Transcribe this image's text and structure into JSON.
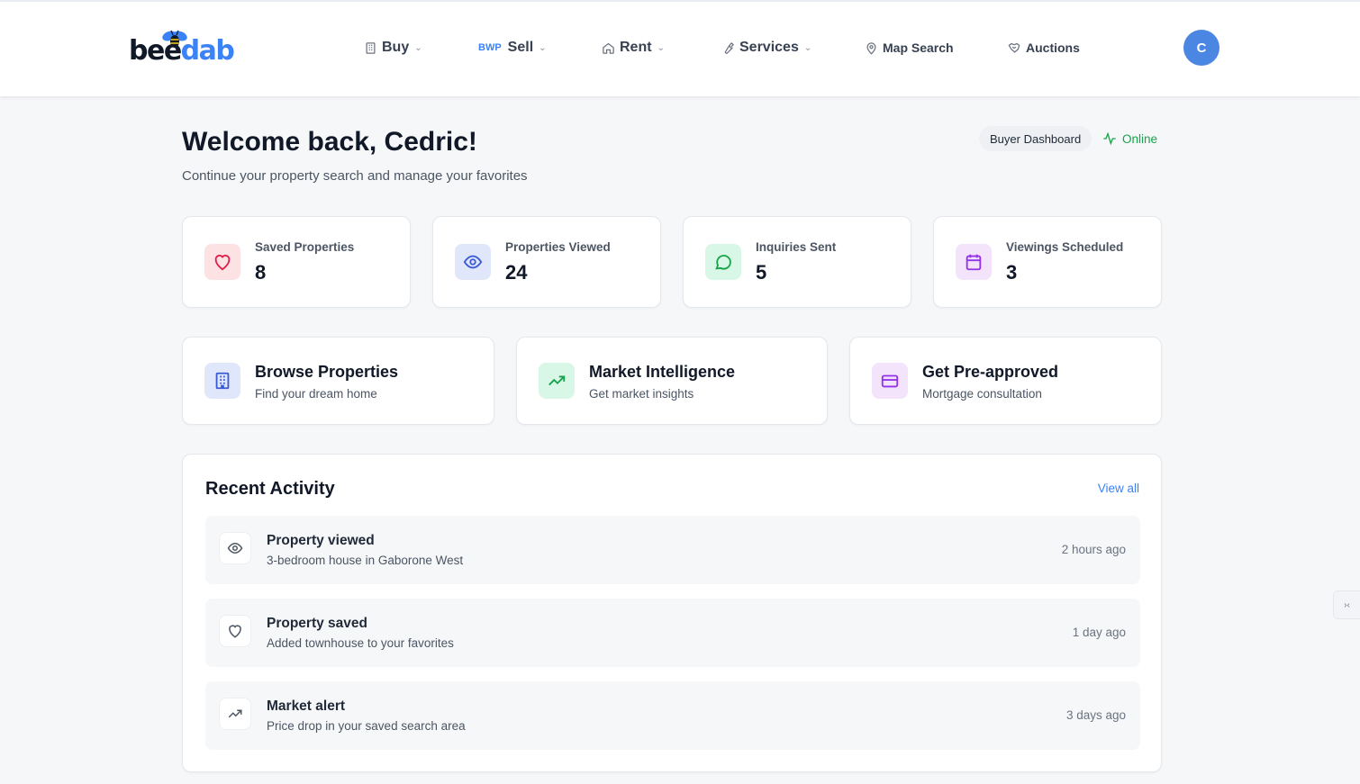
{
  "header": {
    "logo": {
      "part1": "bee",
      "part2": "dab"
    },
    "nav": [
      {
        "label": "Buy",
        "icon": "building-icon",
        "dropdown": true
      },
      {
        "prefix": "BWP",
        "label": "Sell",
        "dropdown": true
      },
      {
        "label": "Rent",
        "icon": "home-icon",
        "dropdown": true
      },
      {
        "label": "Services",
        "icon": "wrench-icon",
        "dropdown": true
      },
      {
        "label": "Map Search",
        "icon": "map-pin-icon",
        "dropdown": false
      },
      {
        "label": "Auctions",
        "icon": "handshake-icon",
        "dropdown": false
      }
    ],
    "avatar_initial": "C"
  },
  "welcome": {
    "title": "Welcome back, Cedric!",
    "subtitle": "Continue your property search and manage your favorites",
    "badge": "Buyer Dashboard",
    "status": "Online"
  },
  "stats": [
    {
      "label": "Saved Properties",
      "value": "8",
      "icon": "heart-icon",
      "color": "#e11d48",
      "bg": "#fde2e4"
    },
    {
      "label": "Properties Viewed",
      "value": "24",
      "icon": "eye-icon",
      "color": "#3b5bd6",
      "bg": "#e0e7fb"
    },
    {
      "label": "Inquiries Sent",
      "value": "5",
      "icon": "message-icon",
      "color": "#16a34a",
      "bg": "#d9f7e6"
    },
    {
      "label": "Viewings Scheduled",
      "value": "3",
      "icon": "calendar-icon",
      "color": "#9333ea",
      "bg": "#f3e3fb"
    }
  ],
  "actions": [
    {
      "title": "Browse Properties",
      "subtitle": "Find your dream home",
      "icon": "building-icon",
      "color": "#3b5bd6",
      "bg": "#e0e7fb"
    },
    {
      "title": "Market Intelligence",
      "subtitle": "Get market insights",
      "icon": "trending-up-icon",
      "color": "#16a34a",
      "bg": "#d9f7e6"
    },
    {
      "title": "Get Pre-approved",
      "subtitle": "Mortgage consultation",
      "icon": "credit-card-icon",
      "color": "#9333ea",
      "bg": "#f3e3fb"
    }
  ],
  "activity": {
    "title": "Recent Activity",
    "view_all": "View all",
    "items": [
      {
        "title": "Property viewed",
        "subtitle": "3-bedroom house in Gaborone West",
        "time": "2 hours ago",
        "icon": "eye-icon"
      },
      {
        "title": "Property saved",
        "subtitle": "Added townhouse to your favorites",
        "time": "1 day ago",
        "icon": "heart-icon"
      },
      {
        "title": "Market alert",
        "subtitle": "Price drop in your saved search area",
        "time": "3 days ago",
        "icon": "trending-up-icon"
      }
    ]
  },
  "side_tab": "›‹"
}
